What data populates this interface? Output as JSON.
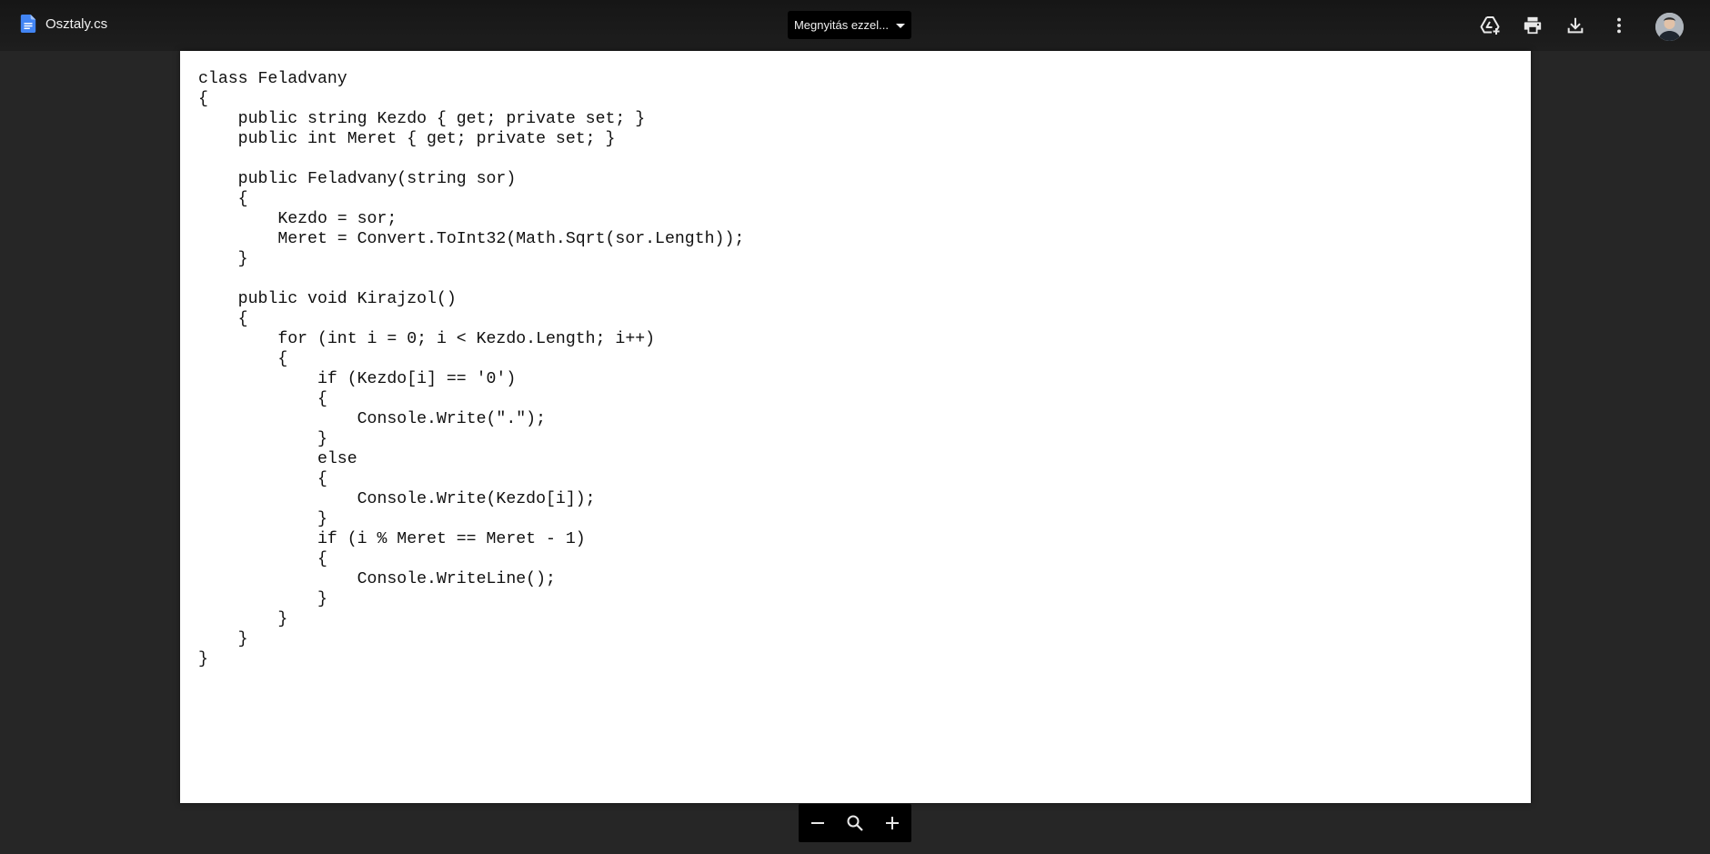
{
  "app": {
    "file_name": "Osztaly.cs",
    "file_icon": "google-docs-icon",
    "accent_color": "#4285f4"
  },
  "header": {
    "open_with_label": "Megnyitás ezzel...",
    "actions": [
      {
        "name": "add-to-drive",
        "icon": "add-to-drive-icon"
      },
      {
        "name": "print",
        "icon": "printer-icon"
      },
      {
        "name": "download",
        "icon": "download-icon"
      },
      {
        "name": "more",
        "icon": "more-vert-icon"
      }
    ],
    "avatar_icon": "user-avatar"
  },
  "document": {
    "code_lines": [
      "class Feladvany",
      "{",
      "    public string Kezdo { get; private set; }",
      "    public int Meret { get; private set; }",
      "",
      "    public Feladvany(string sor)",
      "    {",
      "        Kezdo = sor;",
      "        Meret = Convert.ToInt32(Math.Sqrt(sor.Length));",
      "    }",
      "",
      "    public void Kirajzol()",
      "    {",
      "        for (int i = 0; i < Kezdo.Length; i++)",
      "        {",
      "            if (Kezdo[i] == '0')",
      "            {",
      "                Console.Write(\".\");",
      "            }",
      "            else",
      "            {",
      "                Console.Write(Kezdo[i]);",
      "            }",
      "            if (i % Meret == Meret - 1)",
      "            {",
      "                Console.WriteLine();",
      "            }",
      "        }",
      "    }",
      "}"
    ]
  },
  "zoom_controls": {
    "zoom_out_icon": "minus-icon",
    "zoom_reset_icon": "magnifier-icon",
    "zoom_in_icon": "plus-icon"
  }
}
